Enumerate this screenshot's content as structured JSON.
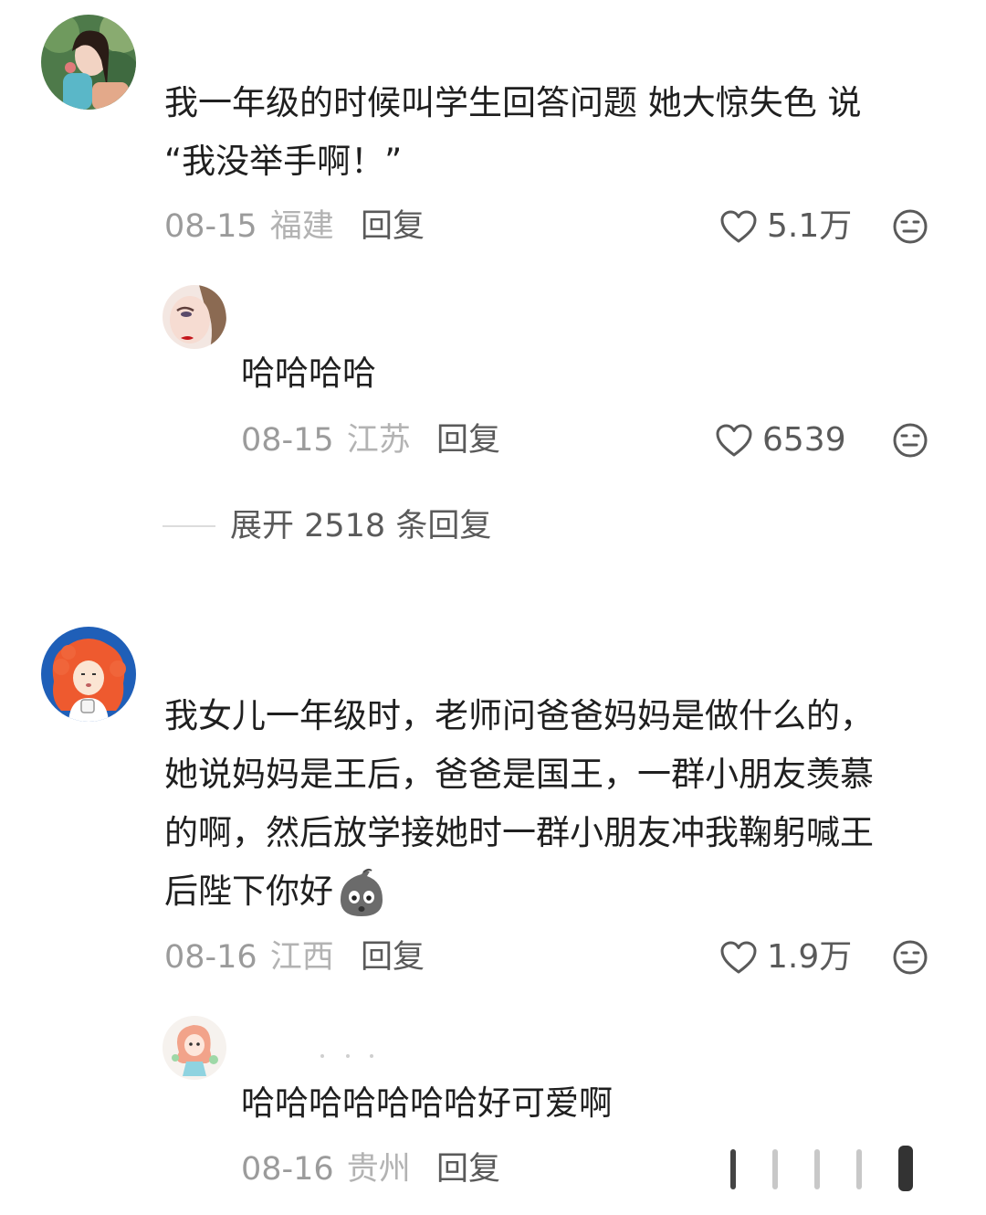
{
  "comments": [
    {
      "lines": [
        "我一年级的时候叫学生回答问题  她大惊失色 说",
        "“我没举手啊！”"
      ],
      "date": "08-15",
      "location": "福建",
      "reply_label": "回复",
      "likes": "5.1万",
      "replies": [
        {
          "text": "哈哈哈哈",
          "date": "08-15",
          "location": "江苏",
          "reply_label": "回复",
          "likes": "6539"
        }
      ],
      "expand_label": "展开 2518 条回复"
    },
    {
      "lines": [
        "我女儿一年级时，老师问爸爸妈妈是做什么的，",
        "她说妈妈是王后，爸爸是国王，一群小朋友羡慕",
        "的啊，然后放学接她时一群小朋友冲我鞠躬喊王",
        "后陛下你好"
      ],
      "date": "08-16",
      "location": "江西",
      "reply_label": "回复",
      "likes": "1.9万",
      "replies": [
        {
          "text": "哈哈哈哈哈哈哈好可爱啊",
          "date": "08-16",
          "location": "贵州",
          "reply_label": "回复"
        }
      ]
    }
  ],
  "icons": {
    "like": "heart-outline-icon",
    "dislike": "meh-face-icon",
    "inline_emoji": "shocked-emoji-icon"
  },
  "colors": {
    "text": "#1f1f1f",
    "meta": "#9b9b9b",
    "action": "#5a5a5a"
  }
}
